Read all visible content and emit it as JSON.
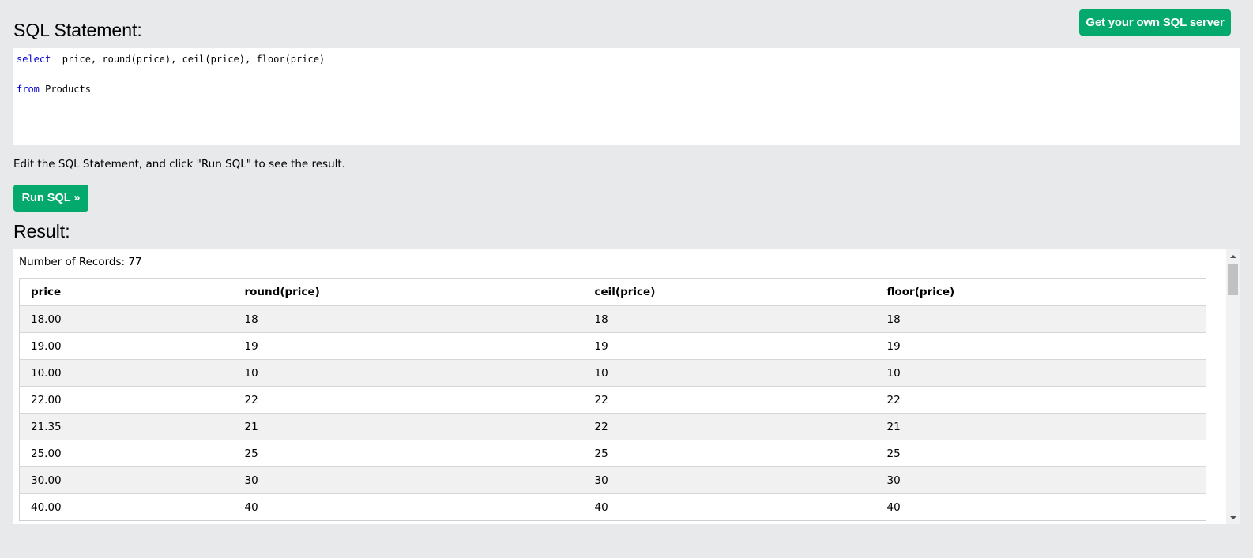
{
  "header": {
    "sql_title": "SQL Statement:",
    "get_server_label": "Get your own SQL server"
  },
  "editor": {
    "line1_kw": "select",
    "line1_rest": "  price, round(price), ceil(price), floor(price)",
    "line2": "",
    "line3_kw": "from",
    "line3_rest": " Products"
  },
  "instruction": "Edit the SQL Statement, and click \"Run SQL\" to see the result.",
  "run_label": "Run SQL »",
  "result": {
    "title": "Result:",
    "record_count": "Number of Records: 77",
    "columns": [
      "price",
      "round(price)",
      "ceil(price)",
      "floor(price)"
    ],
    "rows": [
      [
        "18.00",
        "18",
        "18",
        "18"
      ],
      [
        "19.00",
        "19",
        "19",
        "19"
      ],
      [
        "10.00",
        "10",
        "10",
        "10"
      ],
      [
        "22.00",
        "22",
        "22",
        "22"
      ],
      [
        "21.35",
        "21",
        "22",
        "21"
      ],
      [
        "25.00",
        "25",
        "25",
        "25"
      ],
      [
        "30.00",
        "30",
        "30",
        "30"
      ],
      [
        "40.00",
        "40",
        "40",
        "40"
      ]
    ]
  },
  "colors": {
    "accent": "#04aa6d",
    "background": "#e7e9eb",
    "keyword": "#0000cc"
  }
}
